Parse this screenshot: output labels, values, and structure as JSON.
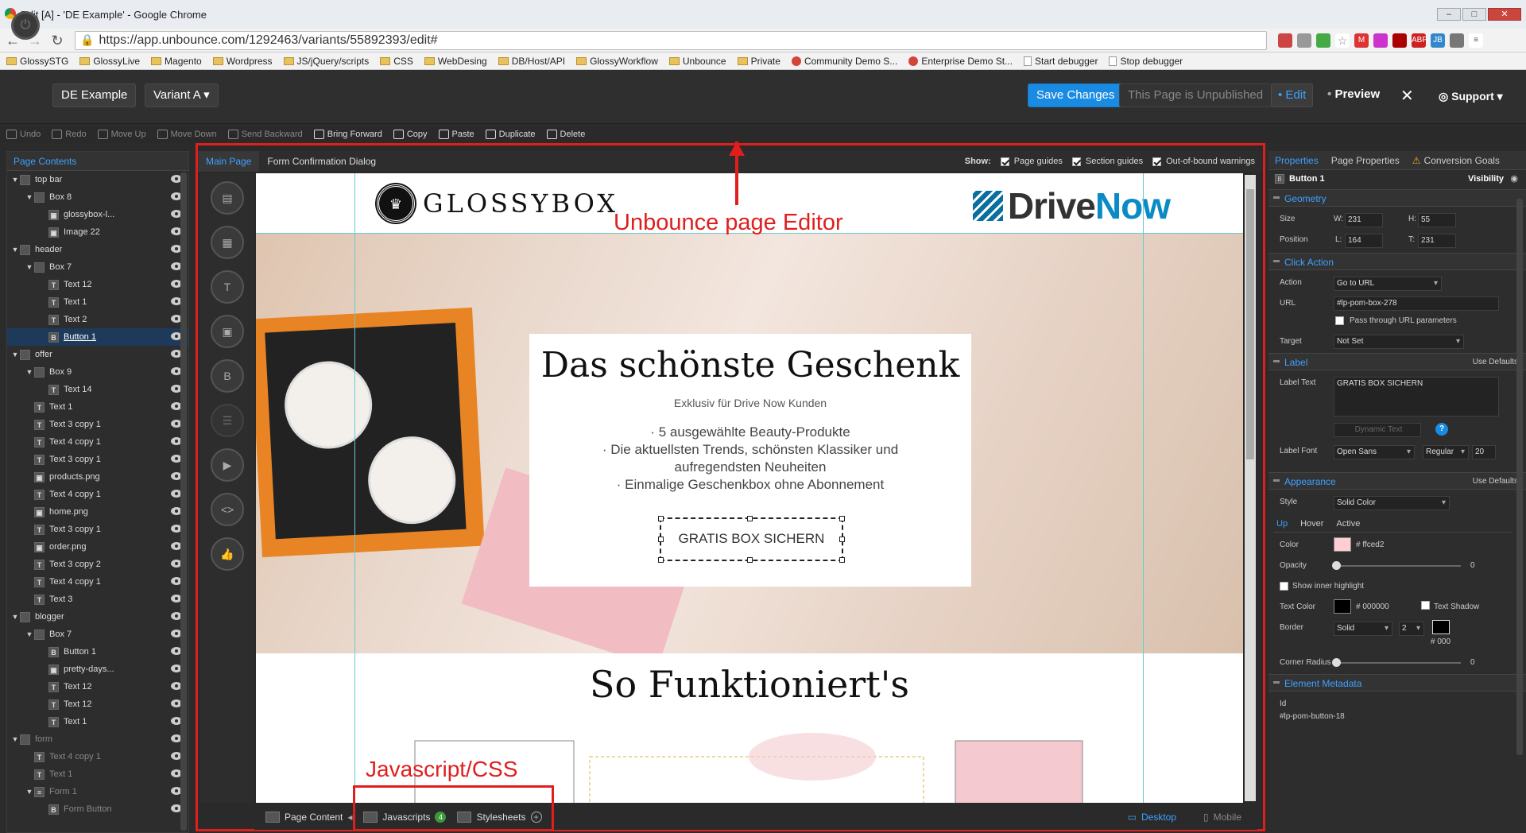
{
  "window": {
    "title": "Edit [A] - 'DE Example' - Google Chrome"
  },
  "browser": {
    "url": "https://app.unbounce.com/1292463/variants/55892393/edit#",
    "bookmarks": [
      "GlossySTG",
      "GlossyLive",
      "Magento",
      "Wordpress",
      "JS/jQuery/scripts",
      "CSS",
      "WebDesing",
      "DB/Host/API",
      "GlossyWorkflow",
      "Unbounce",
      "Private",
      "Community Demo S...",
      "Enterprise Demo St...",
      "Start debugger",
      "Stop debugger"
    ]
  },
  "header": {
    "page_name": "DE Example",
    "variant": "Variant A",
    "save": "Save Changes",
    "status": "This Page is Unpublished",
    "edit": "Edit",
    "preview": "Preview",
    "close": "✕",
    "support": "Support"
  },
  "toolbar": {
    "undo": "Undo",
    "redo": "Redo",
    "move_up": "Move Up",
    "move_down": "Move Down",
    "send_backward": "Send Backward",
    "bring_forward": "Bring Forward",
    "copy": "Copy",
    "paste": "Paste",
    "duplicate": "Duplicate",
    "delete": "Delete"
  },
  "left_panel": {
    "title": "Page Contents",
    "tree": [
      {
        "label": "top bar",
        "depth": 0,
        "icon": "section"
      },
      {
        "label": "Box 8",
        "depth": 1,
        "icon": "box"
      },
      {
        "label": "glossybox-l...",
        "depth": 2,
        "icon": "image"
      },
      {
        "label": "Image 22",
        "depth": 2,
        "icon": "image"
      },
      {
        "label": "header",
        "depth": 0,
        "icon": "section"
      },
      {
        "label": "Box 7",
        "depth": 1,
        "icon": "box"
      },
      {
        "label": "Text 12",
        "depth": 2,
        "icon": "text"
      },
      {
        "label": "Text 1",
        "depth": 2,
        "icon": "text"
      },
      {
        "label": "Text 2",
        "depth": 2,
        "icon": "text"
      },
      {
        "label": "Button 1",
        "depth": 2,
        "icon": "button"
      },
      {
        "label": "offer",
        "depth": 0,
        "icon": "section"
      },
      {
        "label": "Box 9",
        "depth": 1,
        "icon": "box"
      },
      {
        "label": "Text 14",
        "depth": 2,
        "icon": "text"
      },
      {
        "label": "Text 1",
        "depth": 1,
        "icon": "text"
      },
      {
        "label": "Text 3 copy 1",
        "depth": 1,
        "icon": "text"
      },
      {
        "label": "Text 4 copy 1",
        "depth": 1,
        "icon": "text"
      },
      {
        "label": "Text 3 copy 1",
        "depth": 1,
        "icon": "text"
      },
      {
        "label": "products.png",
        "depth": 1,
        "icon": "image"
      },
      {
        "label": "Text 4 copy 1",
        "depth": 1,
        "icon": "text"
      },
      {
        "label": "home.png",
        "depth": 1,
        "icon": "image"
      },
      {
        "label": "Text 3 copy 1",
        "depth": 1,
        "icon": "text"
      },
      {
        "label": "order.png",
        "depth": 1,
        "icon": "image"
      },
      {
        "label": "Text 3 copy 2",
        "depth": 1,
        "icon": "text"
      },
      {
        "label": "Text 4 copy 1",
        "depth": 1,
        "icon": "text"
      },
      {
        "label": "Text 3",
        "depth": 1,
        "icon": "text"
      },
      {
        "label": "blogger",
        "depth": 0,
        "icon": "section"
      },
      {
        "label": "Box 7",
        "depth": 1,
        "icon": "box"
      },
      {
        "label": "Button 1",
        "depth": 2,
        "icon": "button"
      },
      {
        "label": "pretty-days...",
        "depth": 2,
        "icon": "image"
      },
      {
        "label": "Text 12",
        "depth": 2,
        "icon": "text"
      },
      {
        "label": "Text 12",
        "depth": 2,
        "icon": "text"
      },
      {
        "label": "Text 1",
        "depth": 2,
        "icon": "text"
      },
      {
        "label": "form",
        "depth": 0,
        "icon": "section"
      },
      {
        "label": "Text 4 copy 1",
        "depth": 1,
        "icon": "text"
      },
      {
        "label": "Text 1",
        "depth": 1,
        "icon": "text"
      },
      {
        "label": "Form 1",
        "depth": 1,
        "icon": "form"
      },
      {
        "label": "Form Button",
        "depth": 2,
        "icon": "button"
      }
    ]
  },
  "editor": {
    "tabs": [
      "Main Page",
      "Form Confirmation Dialog"
    ],
    "show_label": "Show:",
    "show_options": [
      "Page guides",
      "Section guides",
      "Out-of-bound warnings"
    ],
    "tools": [
      "section-tool",
      "box-tool",
      "text-tool",
      "image-tool",
      "button-tool",
      "form-tool",
      "video-tool",
      "html-tool",
      "social-tool"
    ]
  },
  "canvas": {
    "glossybox_logo": "GLOSSYBOX",
    "drivenow_logo_a": "Drive",
    "drivenow_logo_b": "Now",
    "headline": "Das schönste Geschenk",
    "subline": "Exklusiv für Drive Now Kunden",
    "bullets": [
      "· 5 ausgewählte Beauty-Produkte",
      "· Die aktuellsten Trends, schönsten Klassiker und",
      "aufregendsten Neuheiten",
      "· Einmalige Geschenkbox ohne Abonnement"
    ],
    "cta": "GRATIS BOX SICHERN",
    "section_title": "So Funktioniert's"
  },
  "annotations": {
    "editor_label": "Unbounce page Editor",
    "js_label": "Javascript/CSS"
  },
  "bottom_bar": {
    "page_content": "Page Content",
    "javascripts": "Javascripts",
    "js_count": "4",
    "stylesheets": "Stylesheets",
    "desktop": "Desktop",
    "mobile": "Mobile"
  },
  "right_panel": {
    "tabs": [
      "Properties",
      "Page Properties",
      "Conversion Goals"
    ],
    "element": "Button 1",
    "visibility": "Visibility",
    "geometry": {
      "title": "Geometry",
      "size_label": "Size",
      "w": "231",
      "h": "55",
      "position_label": "Position",
      "l": "164",
      "t": "231"
    },
    "click_action": {
      "title": "Click Action",
      "action_label": "Action",
      "action": "Go to URL",
      "url_label": "URL",
      "url": "#lp-pom-box-278",
      "pass_through": "Pass through URL parameters",
      "target_label": "Target",
      "target": "Not Set"
    },
    "label": {
      "title": "Label",
      "use_defaults": "Use Defaults",
      "text_label": "Label Text",
      "text": "GRATIS BOX SICHERN",
      "dynamic": "Dynamic Text",
      "font_label": "Label Font",
      "font": "Open Sans",
      "weight": "Regular",
      "size": "20"
    },
    "appearance": {
      "title": "Appearance",
      "use_defaults": "Use Defaults",
      "style_label": "Style",
      "style": "Solid Color",
      "states": [
        "Up",
        "Hover",
        "Active"
      ],
      "color_label": "Color",
      "color": "# ffced2",
      "color_hex": "#ffced2",
      "opacity_label": "Opacity",
      "opacity": "0",
      "inner_highlight": "Show inner highlight",
      "text_color_label": "Text Color",
      "text_color": "# 000000",
      "text_shadow": "Text Shadow",
      "border_label": "Border",
      "border_style": "Solid",
      "border_width": "2",
      "border_color": "# 000",
      "radius_label": "Corner Radius",
      "radius": "0"
    },
    "metadata": {
      "title": "Element Metadata",
      "id_label": "Id",
      "id": "#lp-pom-button-18"
    }
  }
}
